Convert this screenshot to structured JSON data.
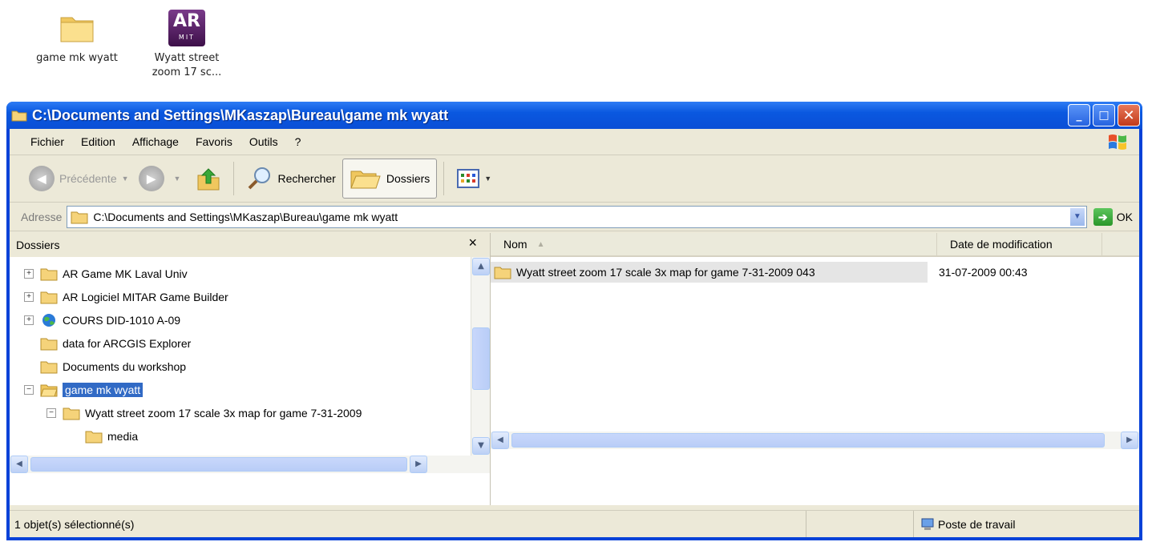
{
  "desktop": {
    "icons": [
      {
        "label": "game mk wyatt",
        "icon": "folder-icon"
      },
      {
        "label_line1": "Wyatt street",
        "label_line2": "zoom 17 sc...",
        "logo_text": "AR",
        "logo_sub": "MIT",
        "icon": "ar-app-icon"
      }
    ]
  },
  "window": {
    "title": "C:\\Documents and Settings\\MKaszap\\Bureau\\game mk wyatt",
    "buttons": {
      "minimize": "_",
      "maximize": "□",
      "close": "✕"
    }
  },
  "menu": [
    "Fichier",
    "Edition",
    "Affichage",
    "Favoris",
    "Outils",
    "?"
  ],
  "toolbar": {
    "back_label": "Précédente",
    "search_label": "Rechercher",
    "folders_label": "Dossiers"
  },
  "address": {
    "label": "Adresse",
    "path": "C:\\Documents and Settings\\MKaszap\\Bureau\\game mk wyatt",
    "go_label": "OK"
  },
  "folders_pane": {
    "title": "Dossiers",
    "close": "×",
    "items": [
      {
        "label": "AR Game MK Laval Univ",
        "expander": "+",
        "icon": "folder-icon"
      },
      {
        "label": "AR Logiciel MITAR Game Builder",
        "expander": "+",
        "icon": "folder-icon"
      },
      {
        "label": "COURS DID-1010 A-09",
        "expander": "+",
        "icon": "globe-icon"
      },
      {
        "label": "data for ARCGIS Explorer",
        "expander": "",
        "icon": "folder-icon"
      },
      {
        "label": "Documents du workshop",
        "expander": "",
        "icon": "folder-icon"
      },
      {
        "label": "game mk wyatt",
        "expander": "−",
        "icon": "folder-open-icon",
        "selected": true
      },
      {
        "label": "Wyatt street zoom 17 scale 3x map for game 7-31-2009",
        "expander": "−",
        "icon": "folder-icon",
        "indent": 1
      },
      {
        "label": "media",
        "expander": "",
        "icon": "folder-icon",
        "indent": 2
      }
    ]
  },
  "file_list": {
    "columns": [
      "Nom",
      "Date de modification"
    ],
    "rows": [
      {
        "name": "Wyatt street zoom 17 scale 3x map for game 7-31-2009 043",
        "date": "31-07-2009 00:43"
      }
    ]
  },
  "status": {
    "left": "1 objet(s) sélectionné(s)",
    "right": "Poste de travail"
  }
}
